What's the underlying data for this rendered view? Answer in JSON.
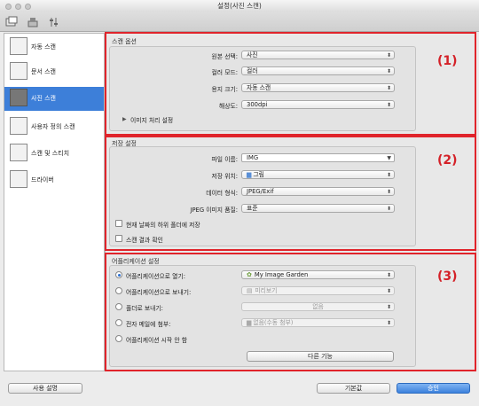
{
  "window": {
    "title": "설정(사진 스캔)"
  },
  "toolbar": {
    "icons": [
      "scan-from-computer-icon",
      "scan-from-operation-panel-icon",
      "general-settings-icon"
    ]
  },
  "sidebar": {
    "items": [
      {
        "label": "자동 스캔"
      },
      {
        "label": "문서 스캔"
      },
      {
        "label": "사진 스캔"
      },
      {
        "label": "사용자 정의 스캔"
      },
      {
        "label": "스캔 및 스티치"
      },
      {
        "label": "드라이버"
      }
    ],
    "active_index": 2
  },
  "scan_options": {
    "title": "스캔 옵션",
    "marker": "(1)",
    "fields": [
      {
        "label": "원본 선택:",
        "value": "사진"
      },
      {
        "label": "컬러 모드:",
        "value": "컬러"
      },
      {
        "label": "용지 크기:",
        "value": "자동 스캔"
      },
      {
        "label": "해상도:",
        "value": "300dpi"
      }
    ],
    "image_processing": "이미지 처리 설정"
  },
  "save_settings": {
    "title": "저장 설정",
    "marker": "(2)",
    "file_name_label": "파일 이름:",
    "file_name_value": "IMG",
    "save_in_label": "저장 위치:",
    "save_in_value": "그림",
    "data_format_label": "데이터 형식:",
    "data_format_value": "JPEG/Exif",
    "jpeg_quality_label": "JPEG 이미지 품질:",
    "jpeg_quality_value": "표준",
    "subfolder_checkbox": "현재 날짜의 하위 폴더에 저장",
    "check_result_checkbox": "스캔 결과 확인"
  },
  "app_settings": {
    "title": "어플리케이션 설정",
    "marker": "(3)",
    "options": [
      {
        "label": "어플리케이션으로 열기:",
        "value": "My Image Garden",
        "selected": true
      },
      {
        "label": "어플리케이션으로 보내기:",
        "value": "미리보기",
        "selected": false
      },
      {
        "label": "폴더로 보내기:",
        "value": "없음",
        "selected": false
      },
      {
        "label": "전자 메일에 첨부:",
        "value": "없음(수동 첨부)",
        "selected": false
      },
      {
        "label": "어플리케이션 시작 안 함",
        "value": "",
        "selected": false
      }
    ],
    "more_functions": "다른 기능"
  },
  "footer": {
    "instructions": "사용 설명",
    "defaults": "기본값",
    "ok": "승인"
  }
}
